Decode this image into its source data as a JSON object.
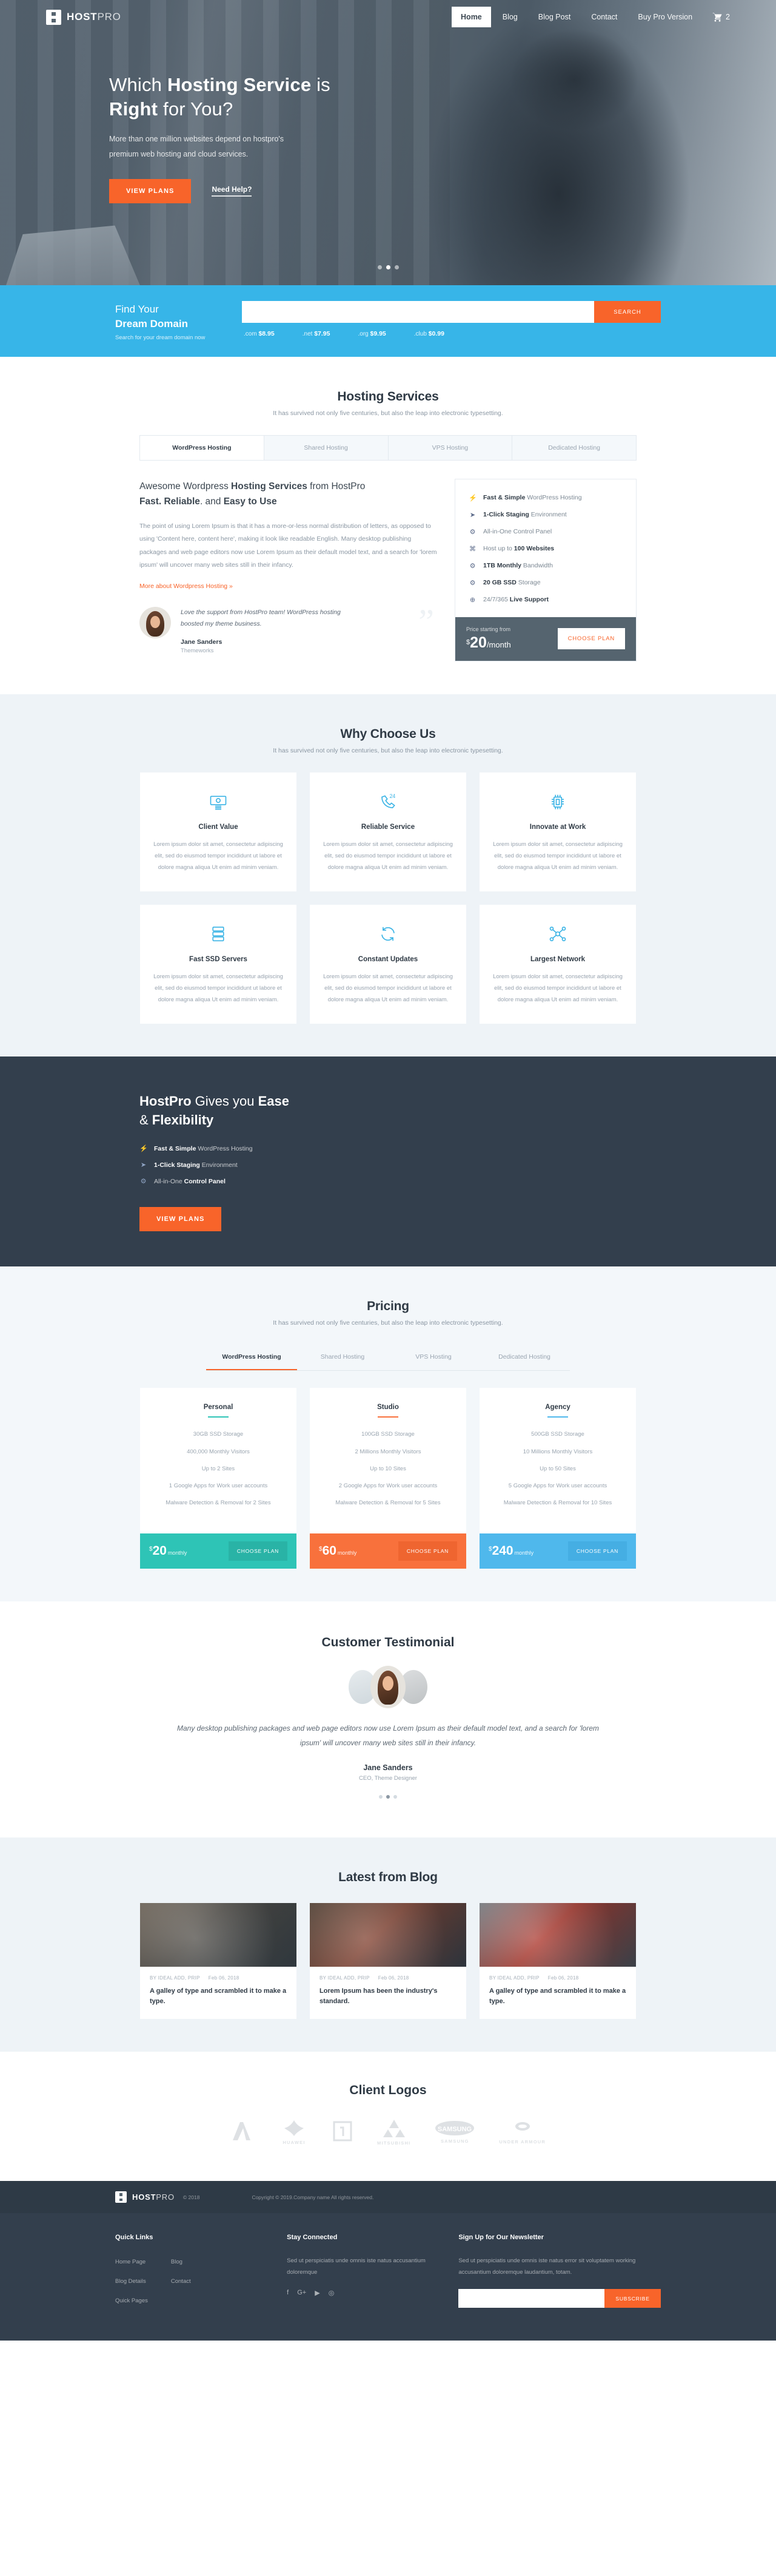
{
  "brand": {
    "name_bold": "HOST",
    "name_light": "PRO"
  },
  "nav": {
    "items": [
      {
        "label": "Home",
        "active": true
      },
      {
        "label": "Blog",
        "active": false
      },
      {
        "label": "Blog Post",
        "active": false
      },
      {
        "label": "Contact",
        "active": false
      },
      {
        "label": "Buy Pro Version",
        "active": false
      }
    ],
    "cart_count": "2",
    "cart_icon": "shopping-cart-icon"
  },
  "hero": {
    "title_p1": "Which ",
    "title_b1": "Hosting Service",
    "title_p2": " is",
    "title_b2": "Right",
    "title_p3": " for You?",
    "subtitle": "More than one million websites depend on hostpro's premium web hosting and cloud services.",
    "cta_primary": "VIEW PLANS",
    "cta_secondary": "Need Help?",
    "slider_dots": 3,
    "slider_active": 1
  },
  "domain": {
    "line1": "Find Your",
    "line2": "Dream Domain",
    "line3": "Search for your dream domain now",
    "input_value": "",
    "input_placeholder": "",
    "search_label": "SEARCH",
    "prices": [
      {
        "tld": ".com",
        "price": "$8.95"
      },
      {
        "tld": ".net",
        "price": "$7.95"
      },
      {
        "tld": ".org",
        "price": "$9.95"
      },
      {
        "tld": ".club",
        "price": "$0.99"
      }
    ]
  },
  "hosting": {
    "title": "Hosting Services",
    "subtitle": "It has survived not only five centuries, but also the leap into electronic typesetting.",
    "tabs": [
      {
        "label": "WordPress Hosting",
        "active": true
      },
      {
        "label": "Shared Hosting",
        "active": false
      },
      {
        "label": "VPS Hosting",
        "active": false
      },
      {
        "label": "Dedicated Hosting",
        "active": false
      }
    ],
    "head_l1_p1": "Awesome Wordpress ",
    "head_l1_b": "Hosting Services",
    "head_l1_p2": " from HostPro",
    "head_l2_b1": "Fast. Reliable",
    "head_l2_p": ". and ",
    "head_l2_b2": "Easy to Use",
    "paragraph": "The point of using Lorem Ipsum is that it has a more-or-less normal distribution of letters, as opposed to using 'Content here, content here', making it look like readable English. Many desktop publishing packages and web page editors now use Lorem Ipsum as their default model text, and a search for 'lorem ipsum' will uncover many web sites still in their infancy.",
    "more_link": "More about Wordpress Hosting »",
    "quote": {
      "text": "Love the support from HostPro team! WordPress hosting boosted my theme business.",
      "name": "Jane Sanders",
      "role": "Themeworks",
      "avatar": "avatar-jane-sanders",
      "mark": "”"
    },
    "features": [
      {
        "icon": "bolt-icon",
        "glyph": "⚡",
        "bold": "Fast & Simple",
        "rest": " WordPress Hosting"
      },
      {
        "icon": "cursor-icon",
        "glyph": "➤",
        "bold": "1-Click Staging",
        "rest": " Environment"
      },
      {
        "icon": "gear-icon",
        "glyph": "⚙",
        "bold": "",
        "rest": "All-in-One Control Panel"
      },
      {
        "icon": "network-icon",
        "glyph": "⌘",
        "bold": "",
        "rest": "Host up to ",
        "bold_after": "100 Websites"
      },
      {
        "icon": "gear-icon",
        "glyph": "⚙",
        "bold": "1TB Monthly",
        "rest": " Bandwidth"
      },
      {
        "icon": "gear-icon",
        "glyph": "⚙",
        "bold": "20 GB SSD",
        "rest": " Storage"
      },
      {
        "icon": "globe-icon",
        "glyph": "⊕",
        "bold": "",
        "rest": "24/7/365 ",
        "bold_after": "Live Support"
      }
    ],
    "price_label": "Price starting from",
    "price_currency": "$",
    "price_amount": "20",
    "price_period": "/month",
    "price_cta": "CHOOSE PLAN"
  },
  "why": {
    "title": "Why Choose Us",
    "subtitle": "It has survived not only five centuries, but also the leap into electronic typesetting.",
    "body": "Lorem ipsum dolor sit amet, consectetur adipiscing elit, sed do eiusmod tempor incididunt ut labore et dolore magna aliqua Ut enim ad minim veniam.",
    "cards": [
      {
        "icon": "money-bill-icon",
        "title": "Client Value"
      },
      {
        "icon": "phone-24h-icon",
        "title": "Reliable Service"
      },
      {
        "icon": "cpu-chip-icon",
        "title": "Innovate at Work"
      },
      {
        "icon": "server-rack-icon",
        "title": "Fast SSD Servers"
      },
      {
        "icon": "refresh-cycle-icon",
        "title": "Constant Updates"
      },
      {
        "icon": "network-nodes-icon",
        "title": "Largest Network"
      }
    ]
  },
  "ease": {
    "l1_b": "HostPro",
    "l1_p": " Gives you ",
    "l1_b2": "Ease",
    "l2_p": "& ",
    "l2_b": "Flexibility",
    "items": [
      {
        "icon": "bolt-icon",
        "glyph": "⚡",
        "bold": "Fast & Simple",
        "rest": " WordPress Hosting"
      },
      {
        "icon": "cursor-icon",
        "glyph": "➤",
        "bold": "1-Click Staging",
        "rest": " Environment"
      },
      {
        "icon": "gear-icon",
        "glyph": "⚙",
        "bold": "",
        "rest": "All-in-One ",
        "bold_after": "Control Panel"
      }
    ],
    "cta": "VIEW PLANS"
  },
  "pricing": {
    "title": "Pricing",
    "subtitle": "It has survived not only five centuries, but also the leap into electronic typesetting.",
    "tabs": [
      {
        "label": "WordPress Hosting",
        "active": true
      },
      {
        "label": "Shared Hosting",
        "active": false
      },
      {
        "label": "VPS Hosting",
        "active": false
      },
      {
        "label": "Dedicated Hosting",
        "active": false
      }
    ],
    "plans": [
      {
        "name": "Personal",
        "color": "#2ec4b6",
        "features": [
          "30GB SSD Storage",
          "400,000 Monthly Visitors",
          "Up to 2 Sites",
          "1 Google Apps for Work user accounts",
          "Malware Detection & Removal for 2 Sites"
        ],
        "currency": "$",
        "amount": "20",
        "period": "monthly",
        "cta": "CHOOSE PLAN"
      },
      {
        "name": "Studio",
        "color": "#f8713c",
        "features": [
          "100GB SSD Storage",
          "2 Millions Monthly Visitors",
          "Up to 10 Sites",
          "2 Google Apps for Work user accounts",
          "Malware Detection & Removal for 5 Sites"
        ],
        "currency": "$",
        "amount": "60",
        "period": "monthly",
        "cta": "CHOOSE PLAN"
      },
      {
        "name": "Agency",
        "color": "#4fb8ec",
        "features": [
          "500GB SSD Storage",
          "10 Millions Monthly Visitors",
          "Up to 50 Sites",
          "5 Google Apps for Work user accounts",
          "Malware Detection & Removal for 10 Sites"
        ],
        "currency": "$",
        "amount": "240",
        "period": "monthly",
        "cta": "CHOOSE PLAN"
      }
    ]
  },
  "testimonial": {
    "title": "Customer Testimonial",
    "quote": "Many desktop publishing packages and web page editors now use Lorem Ipsum as their default model text, and a search for 'lorem ipsum' will uncover many web sites still in their infancy.",
    "name": "Jane Sanders",
    "role": "CEO, Theme Designer",
    "dots": 3,
    "dot_active": 1
  },
  "blog": {
    "title": "Latest from Blog",
    "posts": [
      {
        "author": "BY IDEAL ADD, PRIP",
        "date": "Feb 06, 2018",
        "title": "A galley of type and scrambled it to make a type.",
        "thumb": "blog-thumb-team-meeting"
      },
      {
        "author": "BY IDEAL ADD, PRIP",
        "date": "Feb 06, 2018",
        "title": "Lorem Ipsum has been the industry's standard.",
        "thumb": "blog-thumb-office-work"
      },
      {
        "author": "BY IDEAL ADD, PRIP",
        "date": "Feb 06, 2018",
        "title": "A galley of type and scrambled it to make a type.",
        "thumb": "blog-thumb-discussion"
      }
    ]
  },
  "clients": {
    "title": "Client Logos",
    "logos": [
      {
        "name": "asus-logo",
        "label": ""
      },
      {
        "name": "huawei-logo",
        "label": "HUAWEI"
      },
      {
        "name": "oneplus-logo",
        "label": ""
      },
      {
        "name": "mitsubishi-logo",
        "label": "MITSUBISHI"
      },
      {
        "name": "samsung-logo",
        "label": "SAMSUNG"
      },
      {
        "name": "under-armour-logo",
        "label": "UNDER ARMOUR"
      }
    ]
  },
  "footer": {
    "year": "© 2018",
    "copyright": "Copyright © 2019.Company name All rights reserved.",
    "quick_links_title": "Quick Links",
    "quick_links_col1": [
      "Home Page",
      "Blog Details",
      "Quick Pages"
    ],
    "quick_links_col2": [
      "Blog",
      "Contact"
    ],
    "stay_title": "Stay Connected",
    "stay_text": "Sed ut perspiciatis unde omnis iste natus accusantium doloremque",
    "social": [
      {
        "name": "facebook-icon",
        "glyph": "f"
      },
      {
        "name": "google-plus-icon",
        "glyph": "G+"
      },
      {
        "name": "youtube-icon",
        "glyph": "▶"
      },
      {
        "name": "instagram-icon",
        "glyph": "◎"
      }
    ],
    "newsletter_title": "Sign Up for Our Newsletter",
    "newsletter_text": "Sed ut perspiciatis unde omnis iste natus error sit voluptatem working accusantium doloremque laudantium, totam.",
    "newsletter_value": "",
    "newsletter_placeholder": "",
    "subscribe_label": "SUBSCRIBE"
  }
}
